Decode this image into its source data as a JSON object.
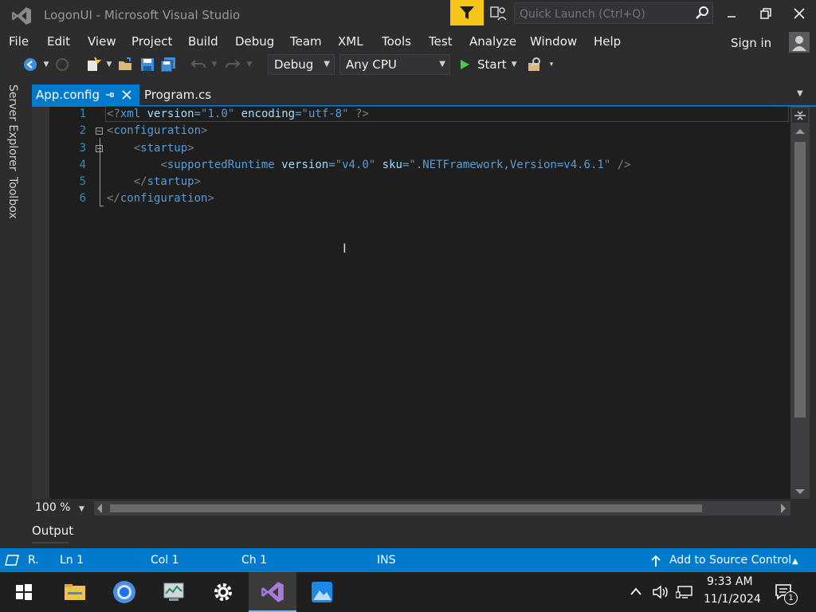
{
  "window": {
    "title": "LogonUI - Microsoft Visual Studio",
    "quick_launch_placeholder": "Quick Launch (Ctrl+Q)"
  },
  "menu": [
    "File",
    "Edit",
    "View",
    "Project",
    "Build",
    "Debug",
    "Team",
    "XML",
    "Tools",
    "Test",
    "Analyze",
    "Window",
    "Help"
  ],
  "account": {
    "signin_label": "Sign in"
  },
  "toolbar": {
    "configuration": "Debug",
    "platform": "Any CPU",
    "start_label": "Start"
  },
  "side_tabs": [
    "Server Explorer",
    "Toolbox"
  ],
  "tabs": [
    {
      "label": "App.config",
      "active": true
    },
    {
      "label": "Program.cs",
      "active": false
    }
  ],
  "editor": {
    "line_numbers": [
      "1",
      "2",
      "3",
      "4",
      "5",
      "6"
    ],
    "lines": [
      "<?xml version=\"1.0\" encoding=\"utf-8\" ?>",
      "<configuration>",
      "    <startup>",
      "        <supportedRuntime version=\"v4.0\" sku=\".NETFramework,Version=v4.6.1\" />",
      "    </startup>",
      "</configuration>"
    ]
  },
  "zoom": "100 %",
  "output_panel": {
    "label": "Output"
  },
  "statusbar": {
    "ready": "R.",
    "line": "Ln 1",
    "col": "Col 1",
    "ch": "Ch 1",
    "mode": "INS",
    "source_control": "Add to Source Control"
  },
  "taskbar": {
    "time": "9:33 AM",
    "date": "11/1/2024",
    "notification_count": "1"
  },
  "colors": {
    "accent": "#007acc",
    "editor_bg": "#1e1e1e",
    "chrome_bg": "#2d2d30",
    "line_number": "#2b91af"
  }
}
